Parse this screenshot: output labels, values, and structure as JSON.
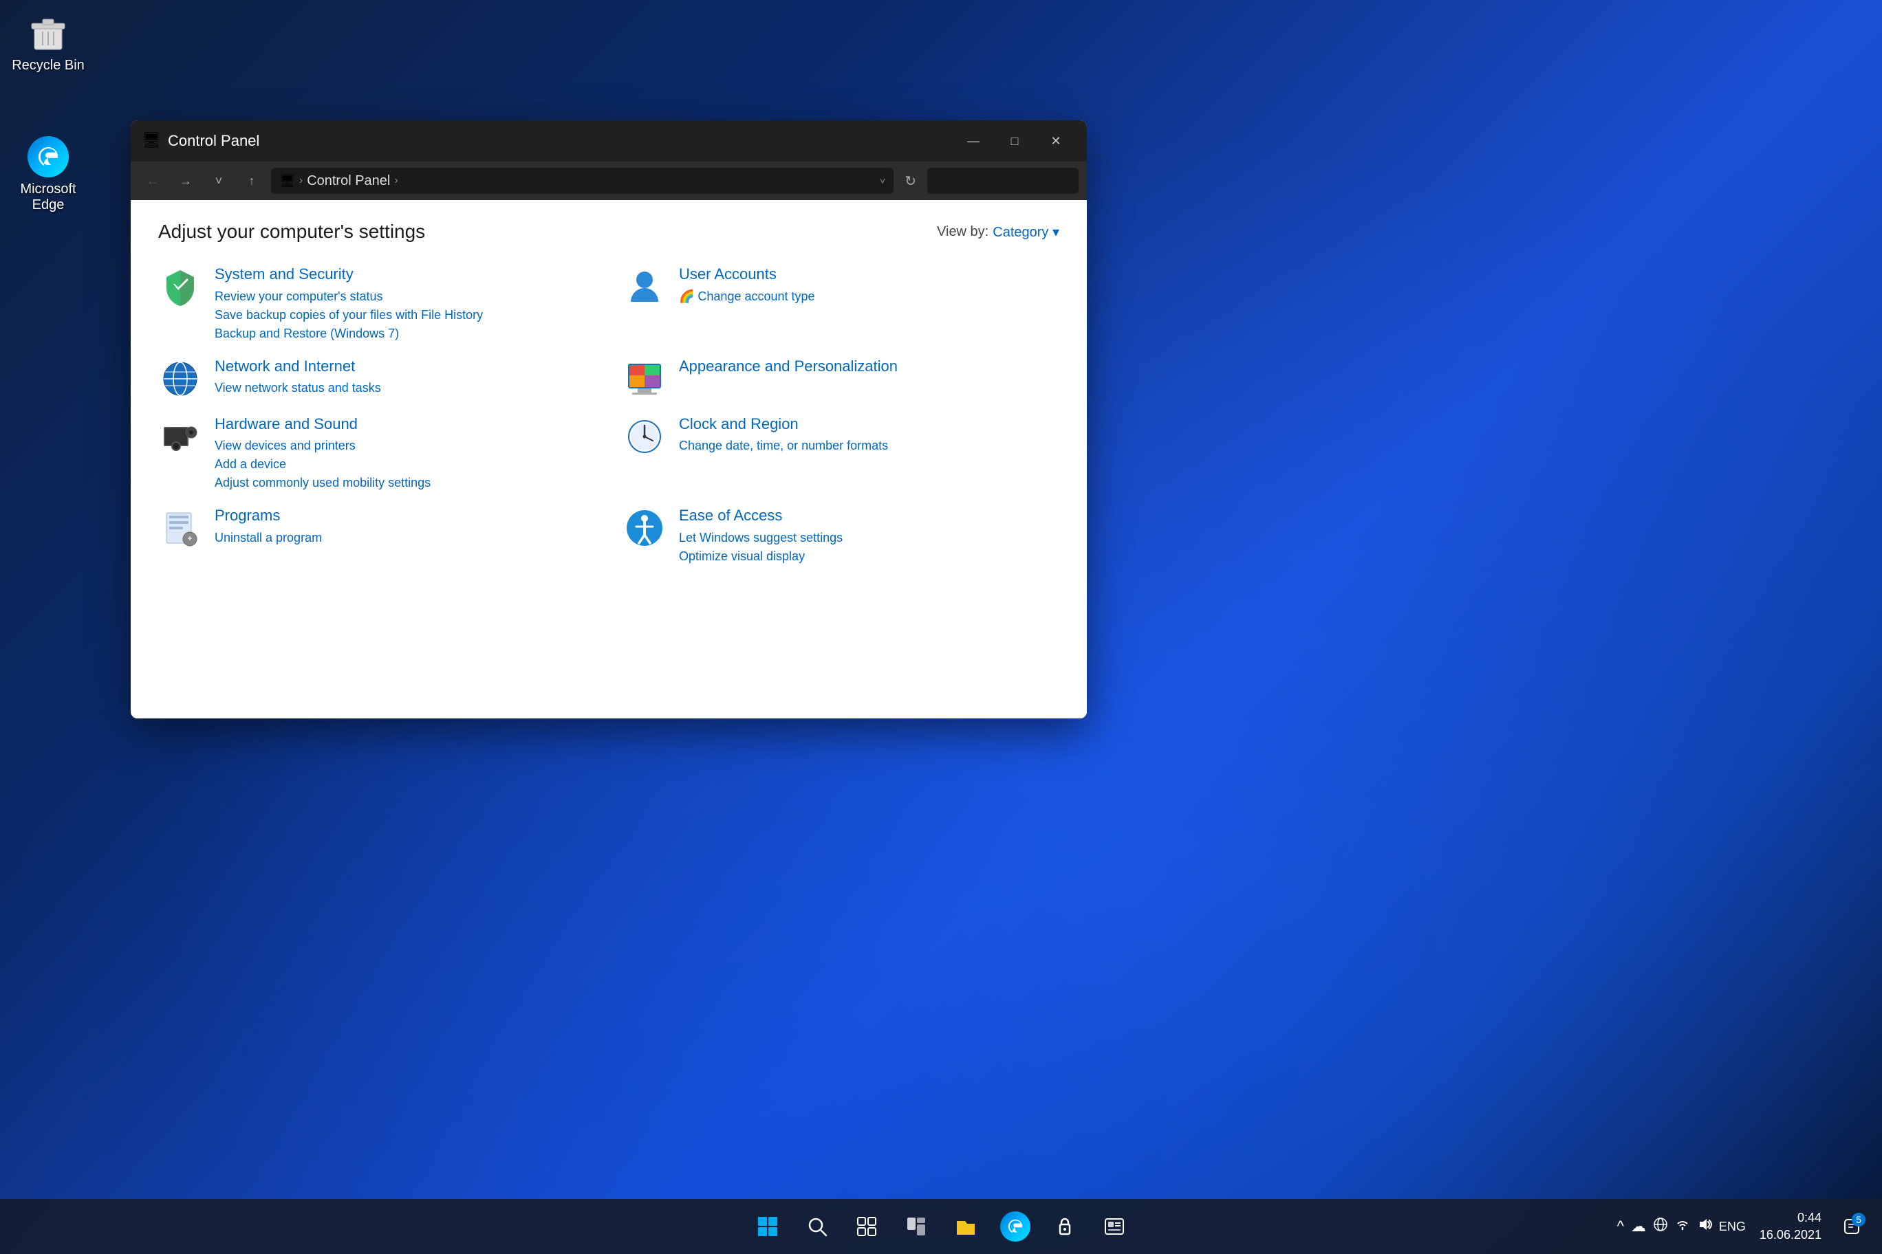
{
  "desktop": {
    "icons": [
      {
        "id": "recycle-bin",
        "label": "Recycle Bin",
        "icon": "🗑️"
      },
      {
        "id": "microsoft-edge",
        "label": "Microsoft Edge",
        "icon": "🌐"
      }
    ]
  },
  "taskbar": {
    "start_label": "⊞",
    "search_label": "🔍",
    "taskview_label": "❑",
    "widgets_label": "▦",
    "files_label": "📁",
    "edge_label": "🌐",
    "vpn_label": "🔒",
    "news_label": "📺",
    "systray": {
      "chevron": "^",
      "cloud": "☁",
      "network": "🌐",
      "wifi": "📶",
      "volume": "🔊",
      "language": "ENG",
      "time": "0:44",
      "date": "16.06.2021",
      "notification": "5"
    }
  },
  "window": {
    "title": "Control Panel",
    "titlebar_icon": "🖥",
    "controls": {
      "minimize": "—",
      "maximize": "□",
      "close": "✕"
    },
    "addressbar": {
      "back_icon": "←",
      "forward_icon": "→",
      "dropdown_icon": "˅",
      "up_icon": "↑",
      "path_icon": "🖥",
      "path_parts": [
        "Control Panel"
      ],
      "refresh_icon": "↻",
      "search_placeholder": ""
    },
    "content": {
      "heading": "Adjust your computer's settings",
      "viewby_label": "View by:",
      "viewby_value": "Category ▾",
      "categories": [
        {
          "id": "system-security",
          "title": "System and Security",
          "icon": "🛡",
          "links": [
            "Review your computer's status",
            "Save backup copies of your files with File History",
            "Backup and Restore (Windows 7)"
          ]
        },
        {
          "id": "user-accounts",
          "title": "User Accounts",
          "icon": "👤",
          "links": [
            "🌈 Change account type"
          ]
        },
        {
          "id": "network-internet",
          "title": "Network and Internet",
          "icon": "🌐",
          "links": [
            "View network status and tasks"
          ]
        },
        {
          "id": "appearance-personalization",
          "title": "Appearance and Personalization",
          "icon": "🖥",
          "links": []
        },
        {
          "id": "hardware-sound",
          "title": "Hardware and Sound",
          "icon": "🖨",
          "links": [
            "View devices and printers",
            "Add a device",
            "Adjust commonly used mobility settings"
          ]
        },
        {
          "id": "clock-region",
          "title": "Clock and Region",
          "icon": "🕐",
          "links": [
            "Change date, time, or number formats"
          ]
        },
        {
          "id": "programs",
          "title": "Programs",
          "icon": "📄",
          "links": [
            "Uninstall a program"
          ]
        },
        {
          "id": "ease-of-access",
          "title": "Ease of Access",
          "icon": "♿",
          "links": [
            "Let Windows suggest settings",
            "Optimize visual display"
          ]
        }
      ]
    }
  }
}
